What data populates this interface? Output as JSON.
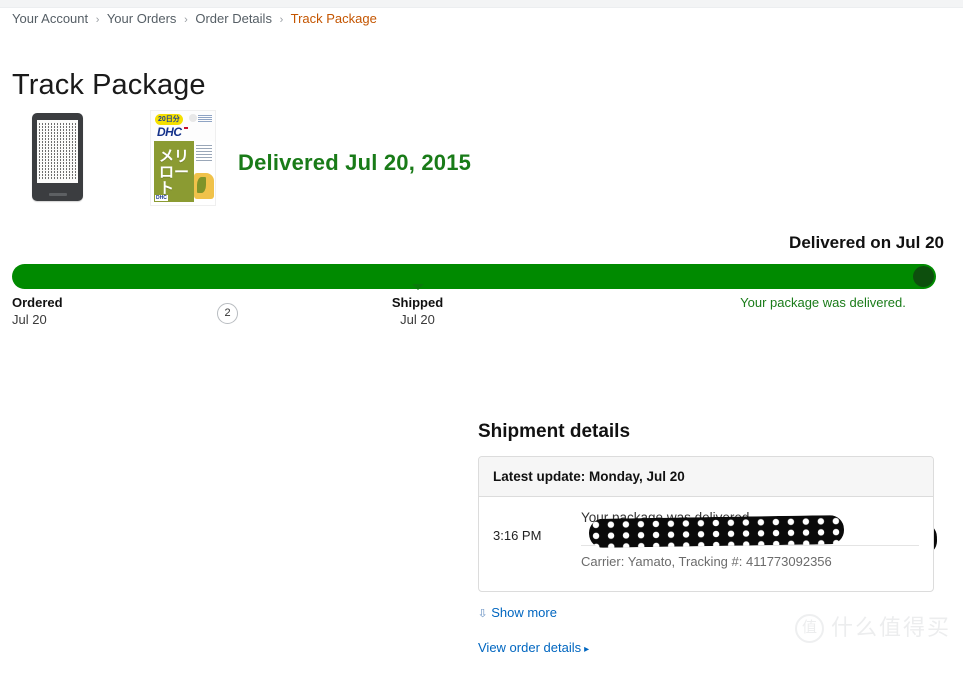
{
  "breadcrumb": {
    "separator": "›",
    "items": [
      {
        "label": "Your Account",
        "current": false
      },
      {
        "label": "Your Orders",
        "current": false
      },
      {
        "label": "Order Details",
        "current": false
      },
      {
        "label": "Track Package",
        "current": true
      }
    ]
  },
  "page": {
    "title": "Track Package"
  },
  "products": [
    {
      "name": "kindle-ereader",
      "quantity": null
    },
    {
      "name": "dhc-supplement",
      "badge_20": "20日分",
      "brand": "DHC",
      "red_tag": "機能性表示食品",
      "kana": "メリロート",
      "foot": "DHC",
      "quantity": "2"
    }
  ],
  "status": {
    "headline": "Delivered Jul 20, 2015",
    "headline_color": "#197b18"
  },
  "tracker": {
    "end_label": "Delivered on Jul 20",
    "progress_percent": 100,
    "bar_color": "#008a00",
    "knob_color": "#0d4f0d",
    "stops": [
      {
        "name": "Ordered",
        "date": "Jul 20"
      },
      {
        "name": "Shipped",
        "date": "Jul 20"
      },
      {
        "name": "Your package was delivered.",
        "date": ""
      }
    ]
  },
  "shipment": {
    "heading": "Shipment details",
    "panel_header": "Latest update: Monday, Jul 20",
    "event": {
      "time": "3:16 PM",
      "text": "Your package was delivered.",
      "carrier": "Carrier: Yamato, Tracking #: 411773092356"
    },
    "show_more_label": "Show more",
    "view_order_details_label": "View order details"
  },
  "watermark": {
    "logo_char": "值",
    "text": "什么值得买"
  }
}
